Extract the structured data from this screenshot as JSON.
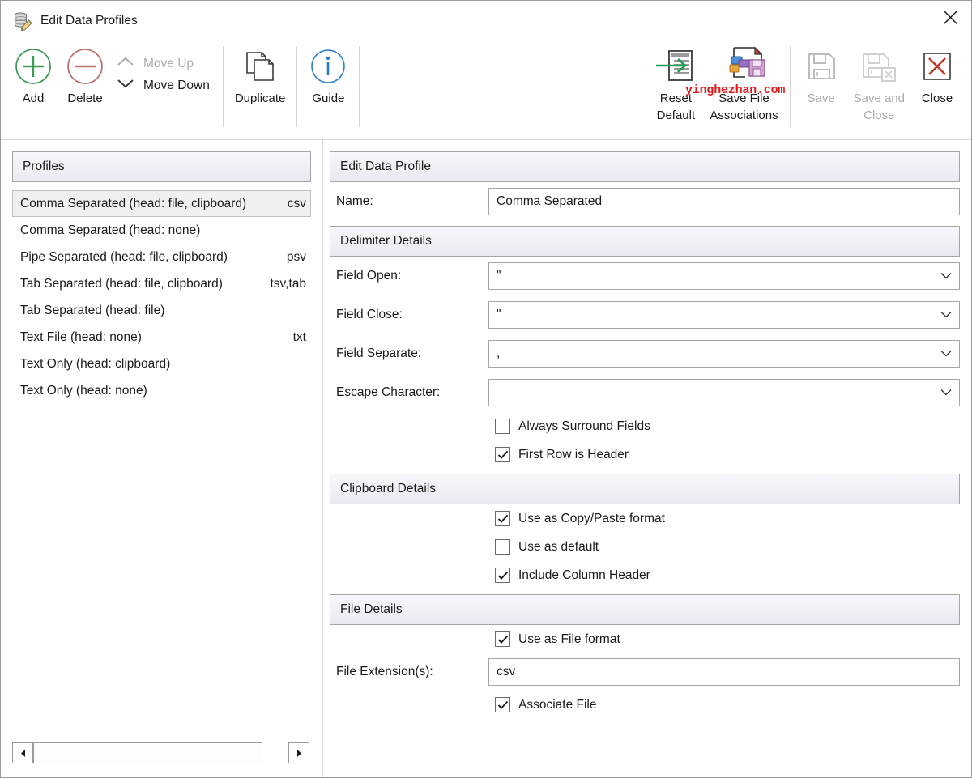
{
  "window": {
    "title": "Edit Data Profiles",
    "title_icon": "data-profile-edit-icon",
    "close_label": "Close window"
  },
  "watermark": {
    "text": "yinghezhan.com",
    "color": "#e01b1b"
  },
  "toolbar": {
    "add": {
      "label": "Add",
      "icon": "plus-circle-icon",
      "color": "#2d8a42"
    },
    "delete": {
      "label": "Delete",
      "icon": "minus-circle-icon",
      "color": "#c0504d"
    },
    "move_up": {
      "label": "Move Up",
      "icon": "chevron-up-icon",
      "disabled": true
    },
    "move_down": {
      "label": "Move Down",
      "icon": "chevron-down-icon",
      "disabled": false
    },
    "duplicate": {
      "label": "Duplicate",
      "icon": "duplicate-pages-icon"
    },
    "guide": {
      "label": "Guide",
      "icon": "info-circle-icon",
      "color": "#1f7ac4"
    },
    "reset_default": {
      "label": "Reset\nDefault",
      "icon": "reset-default-icon"
    },
    "save_file_associations": {
      "label": "Save File\nAssociations",
      "icon": "save-file-associations-icon"
    },
    "save": {
      "label": "Save",
      "icon": "floppy-disk-icon",
      "disabled": true
    },
    "save_and_close": {
      "label": "Save and\nClose",
      "icon": "floppy-disk-close-icon",
      "disabled": true
    },
    "close": {
      "label": "Close",
      "icon": "close-x-box-icon",
      "color": "#c0392b"
    }
  },
  "profiles_panel": {
    "header": "Profiles",
    "items": [
      {
        "name": "Comma Separated (head: file, clipboard)",
        "ext": "csv",
        "selected": true
      },
      {
        "name": "Comma Separated (head: none)",
        "ext": "",
        "selected": false
      },
      {
        "name": "Pipe Separated (head: file, clipboard)",
        "ext": "psv",
        "selected": false
      },
      {
        "name": "Tab Separated (head: file, clipboard)",
        "ext": "tsv,tab",
        "selected": false
      },
      {
        "name": "Tab Separated (head: file)",
        "ext": "",
        "selected": false
      },
      {
        "name": "Text File (head: none)",
        "ext": "txt",
        "selected": false
      },
      {
        "name": "Text Only (head: clipboard)",
        "ext": "",
        "selected": false
      },
      {
        "name": "Text Only (head: none)",
        "ext": "",
        "selected": false
      }
    ],
    "scrollbar": {
      "left_arrow": "◀",
      "right_arrow": "▶"
    }
  },
  "editor": {
    "header": "Edit Data Profile",
    "name_label": "Name:",
    "name_value": "Comma Separated",
    "delimiter_header": "Delimiter Details",
    "field_open_label": "Field Open:",
    "field_open_value": "\"",
    "field_close_label": "Field Close:",
    "field_close_value": "\"",
    "field_separate_label": "Field Separate:",
    "field_separate_value": ",",
    "escape_char_label": "Escape Character:",
    "escape_char_value": "",
    "always_surround_label": "Always Surround Fields",
    "always_surround_checked": false,
    "first_row_header_label": "First Row is Header",
    "first_row_header_checked": true,
    "clipboard_header": "Clipboard Details",
    "use_copy_paste_label": "Use as Copy/Paste format",
    "use_copy_paste_checked": true,
    "use_default_label": "Use as default",
    "use_default_checked": false,
    "include_column_header_label": "Include Column Header",
    "include_column_header_checked": true,
    "file_header": "File Details",
    "use_file_format_label": "Use as File format",
    "use_file_format_checked": true,
    "file_extension_label": "File Extension(s):",
    "file_extension_value": "csv",
    "associate_file_label": "Associate File",
    "associate_file_checked": true
  }
}
